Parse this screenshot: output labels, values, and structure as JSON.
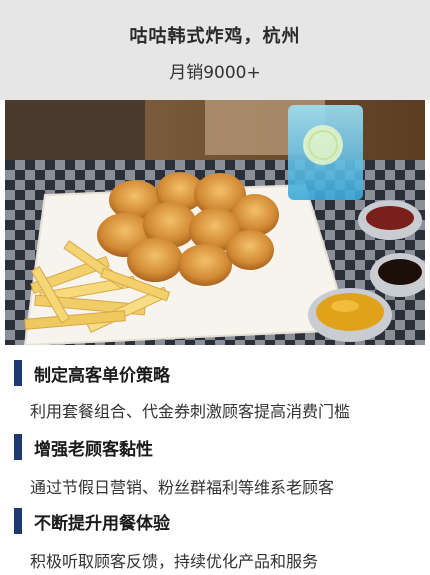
{
  "header": {
    "title": "咕咕韩式炸鸡，杭州",
    "subtitle": "月销9000+"
  },
  "photo": {
    "icon": "fried-chicken-photo"
  },
  "sections": [
    {
      "title": "制定高客单价策略",
      "body": "利用套餐组合、代金券刺激顾客提高消费门槛"
    },
    {
      "title": "增强老顾客黏性",
      "body": "通过节假日营销、粉丝群福利等维系老顾客"
    },
    {
      "title": "不断提升用餐体验",
      "body": "积极听取顾客反馈，持续优化产品和服务"
    }
  ],
  "colors": {
    "header_bg": "#e6e6e6",
    "accent_bar": "#1f3a6e"
  }
}
